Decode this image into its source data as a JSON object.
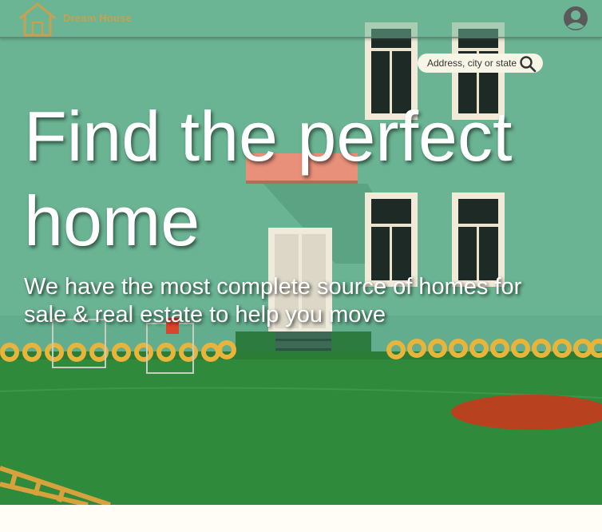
{
  "header": {
    "brand_name": "Dream House",
    "logo_icon": "house-outline-icon",
    "account_icon": "user-circle-icon"
  },
  "search": {
    "placeholder": "Address, city or state",
    "icon": "search-icon"
  },
  "hero": {
    "title": "Find the perfect home",
    "subtitle": "We have the most complete source of homes for sale & real estate to help you move"
  },
  "colors": {
    "brand_gold": "#c9a04e",
    "wall_green": "#6cb596",
    "lawn_green": "#2f8a3c",
    "search_bg": "#f6f5e6",
    "page_bg": "#fffdf5"
  }
}
